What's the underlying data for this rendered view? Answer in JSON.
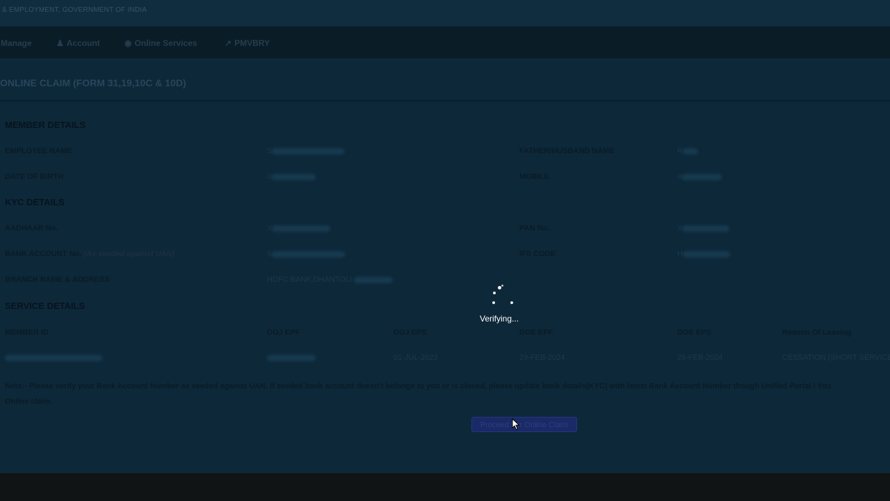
{
  "header": {
    "ministry_text": "& EMPLOYMENT, GOVERNMENT OF INDIA"
  },
  "nav": {
    "items": [
      {
        "label": "Manage",
        "icon": ""
      },
      {
        "label": "Account",
        "icon": "user-icon"
      },
      {
        "label": "Online Services",
        "icon": "globe-icon"
      },
      {
        "label": "PMVBRY",
        "icon": "chart-icon"
      }
    ]
  },
  "page": {
    "title": "ONLINE CLAIM (FORM 31,19,10C & 10D)"
  },
  "member_details": {
    "heading": "MEMBER DETAILS",
    "employee_name_label": "EMPLOYEE NAME",
    "employee_name_value": "S",
    "father_name_label": "FATHER/HUSBAND NAME",
    "father_name_value": "R",
    "dob_label": "DATE OF BIRTH",
    "dob_value": "0",
    "mobile_label": "MOBILE",
    "mobile_value": "9"
  },
  "kyc_details": {
    "heading": "KYC DETAILS",
    "aadhaar_label": "AADHAAR No.",
    "aadhaar_value": "X",
    "pan_label": "PAN No.",
    "pan_value": "X",
    "bank_label": "BANK ACCOUNT No.",
    "bank_label_note": "(As seeded against UAN)",
    "bank_value": "5",
    "ifsc_label": "IFS CODE",
    "ifsc_value": "H",
    "branch_label": "BRANCH NAME & ADDRESS",
    "branch_value": "HDFC BANK,DHANTOLI"
  },
  "service_details": {
    "heading": "SERVICE DETAILS",
    "columns": [
      "MEMBER ID",
      "DOJ EPF",
      "DOJ EPS",
      "DOE EPF",
      "DOE EPS",
      "Reason Of Leaving"
    ],
    "row": {
      "doj_eps": "01-JUL-2023",
      "doe_epf": "29-FEB-2024",
      "doe_eps": "29-FEB-2024",
      "reason": "CESSATION (SHORT SERVICE)"
    }
  },
  "note": {
    "text": "Note:- Please verify your Bank Account Number as seeded against UAN. If seeded bank account doesn't belongs to you or is closed, please update bank details(KYC) with latest Bank Account Number though Unified Portal / You",
    "text2": "Online claim."
  },
  "actions": {
    "proceed_label": "Proceed For Online Claim"
  },
  "loader": {
    "text": "Verifying..."
  }
}
